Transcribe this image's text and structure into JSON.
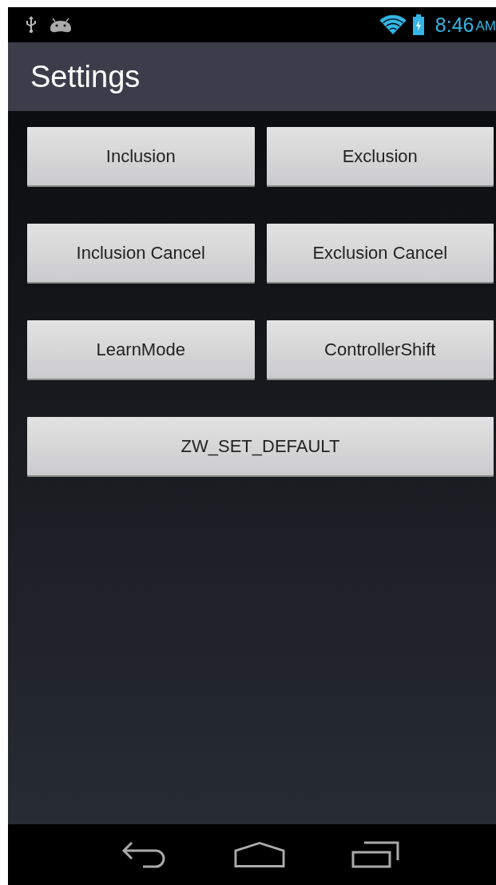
{
  "status_bar": {
    "time": "8:46",
    "meridiem": "AM"
  },
  "action_bar": {
    "title": "Settings"
  },
  "button_rows": [
    {
      "buttons": [
        "Inclusion",
        "Exclusion"
      ]
    },
    {
      "buttons": [
        "Inclusion Cancel",
        "Exclusion Cancel"
      ]
    },
    {
      "buttons": [
        "LearnMode",
        "ControllerShift"
      ]
    },
    {
      "buttons": [
        "ZW_SET_DEFAULT"
      ]
    }
  ]
}
